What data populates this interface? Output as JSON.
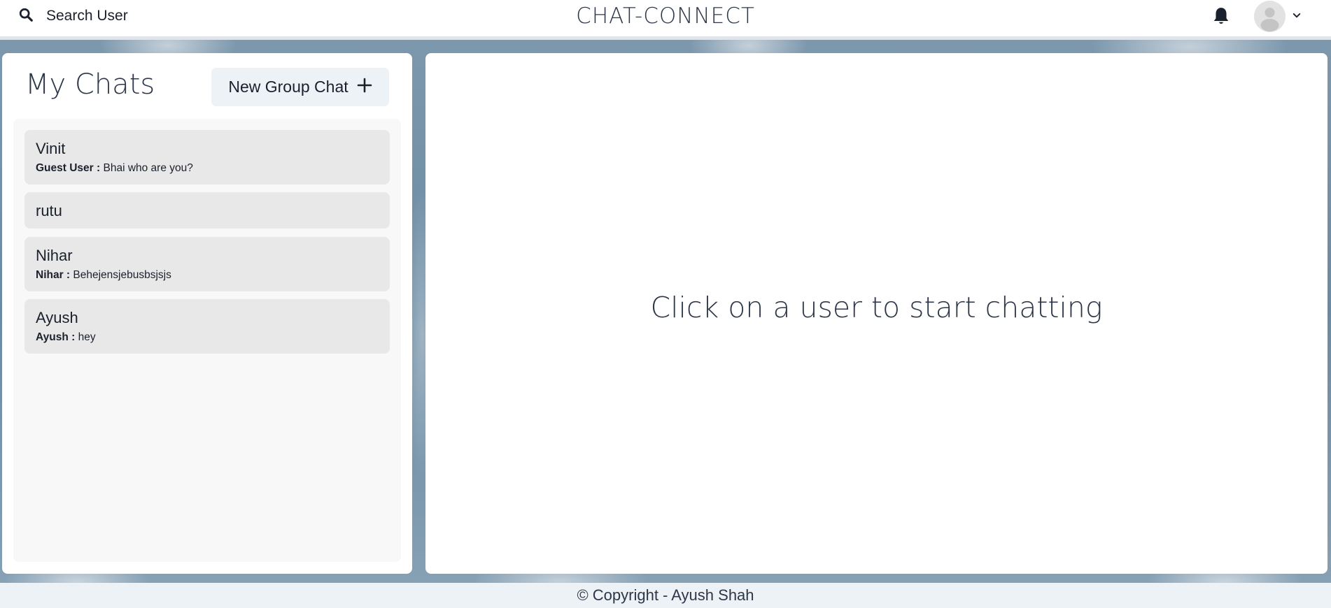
{
  "header": {
    "search_label": "Search User",
    "app_title": "CHAT-CONNECT",
    "icons": {
      "search": "search-icon",
      "notifications": "bell-icon",
      "avatar": "user-avatar-icon",
      "menu": "chevron-down-icon"
    }
  },
  "sidebar": {
    "title": "My Chats",
    "new_group_label": "New Group Chat",
    "new_group_icon": "plus-icon",
    "chats": [
      {
        "name": "Vinit",
        "sender": "Guest User :",
        "message": "Bhai who are you?"
      },
      {
        "name": "rutu",
        "sender": "",
        "message": ""
      },
      {
        "name": "Nihar",
        "sender": "Nihar :",
        "message": "Behejensjebusbsjsjs"
      },
      {
        "name": "Ayush",
        "sender": "Ayush :",
        "message": "hey"
      }
    ]
  },
  "main": {
    "empty_message": "Click on a user to start chatting"
  },
  "footer": {
    "copyright": "© Copyright - Ayush Shah"
  },
  "colors": {
    "background": "#6f8ea6",
    "panel": "#ffffff",
    "chat_item": "#e8e8e8",
    "button": "#edf2f7",
    "text": "#1a202c"
  }
}
